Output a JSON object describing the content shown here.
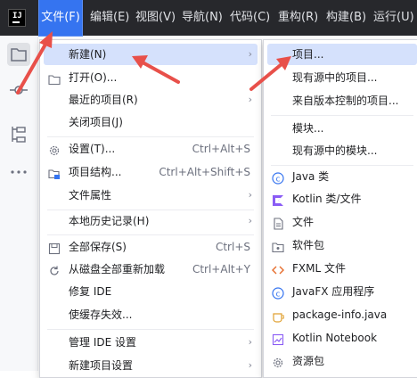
{
  "menubar": {
    "logo_text": "IJ",
    "items": [
      {
        "label": "文件(F)"
      },
      {
        "label": "编辑(E)"
      },
      {
        "label": "视图(V)"
      },
      {
        "label": "导航(N)"
      },
      {
        "label": "代码(C)"
      },
      {
        "label": "重构(R)"
      },
      {
        "label": "构建(B)"
      },
      {
        "label": "运行(U)"
      }
    ]
  },
  "sidebar": {
    "icons": [
      "folder-icon",
      "commit-icon",
      "structure-icon",
      "more-icon"
    ]
  },
  "file_menu": {
    "items": [
      {
        "label": "新建(N)",
        "shortcut": "",
        "submenu": true,
        "icon": ""
      },
      {
        "label": "打开(O)...",
        "shortcut": "",
        "submenu": false,
        "icon": "folder-icon"
      },
      {
        "label": "最近的项目(R)",
        "shortcut": "",
        "submenu": true,
        "icon": ""
      },
      {
        "label": "关闭项目(J)",
        "shortcut": "",
        "submenu": false,
        "icon": ""
      },
      {
        "label": "设置(T)...",
        "shortcut": "Ctrl+Alt+S",
        "submenu": false,
        "icon": "gear-icon"
      },
      {
        "label": "项目结构...",
        "shortcut": "Ctrl+Alt+Shift+S",
        "submenu": false,
        "icon": "project-structure-icon"
      },
      {
        "label": "文件属性",
        "shortcut": "",
        "submenu": true,
        "icon": ""
      },
      {
        "label": "本地历史记录(H)",
        "shortcut": "",
        "submenu": true,
        "icon": ""
      },
      {
        "label": "全部保存(S)",
        "shortcut": "Ctrl+S",
        "submenu": false,
        "icon": "save-icon"
      },
      {
        "label": "从磁盘全部重新加载",
        "shortcut": "Ctrl+Alt+Y",
        "submenu": false,
        "icon": "reload-icon"
      },
      {
        "label": "修复 IDE",
        "shortcut": "",
        "submenu": false,
        "icon": ""
      },
      {
        "label": "使缓存失效...",
        "shortcut": "",
        "submenu": false,
        "icon": ""
      },
      {
        "label": "管理 IDE 设置",
        "shortcut": "",
        "submenu": true,
        "icon": ""
      },
      {
        "label": "新建项目设置",
        "shortcut": "",
        "submenu": true,
        "icon": ""
      }
    ]
  },
  "new_menu": {
    "items": [
      {
        "label": "项目...",
        "icon": ""
      },
      {
        "label": "现有源中的项目...",
        "icon": ""
      },
      {
        "label": "来自版本控制的项目...",
        "icon": ""
      },
      {
        "label": "模块...",
        "icon": ""
      },
      {
        "label": "现有源中的模块...",
        "icon": ""
      },
      {
        "label": "Java 类",
        "icon": "java-class-icon"
      },
      {
        "label": "Kotlin 类/文件",
        "icon": "kotlin-icon"
      },
      {
        "label": "文件",
        "icon": "file-icon"
      },
      {
        "label": "软件包",
        "icon": "package-icon"
      },
      {
        "label": "FXML 文件",
        "icon": "fxml-icon"
      },
      {
        "label": "JavaFX 应用程序",
        "icon": "javafx-icon"
      },
      {
        "label": "package-info.java",
        "icon": "package-info-icon"
      },
      {
        "label": "Kotlin Notebook",
        "icon": "notebook-icon"
      },
      {
        "label": "资源包",
        "icon": "resource-bundle-icon"
      }
    ]
  },
  "colors": {
    "accent": "#3574f0",
    "highlight": "#d5e1fc",
    "arrow": "#e8504a",
    "menubar": "#27282c"
  }
}
